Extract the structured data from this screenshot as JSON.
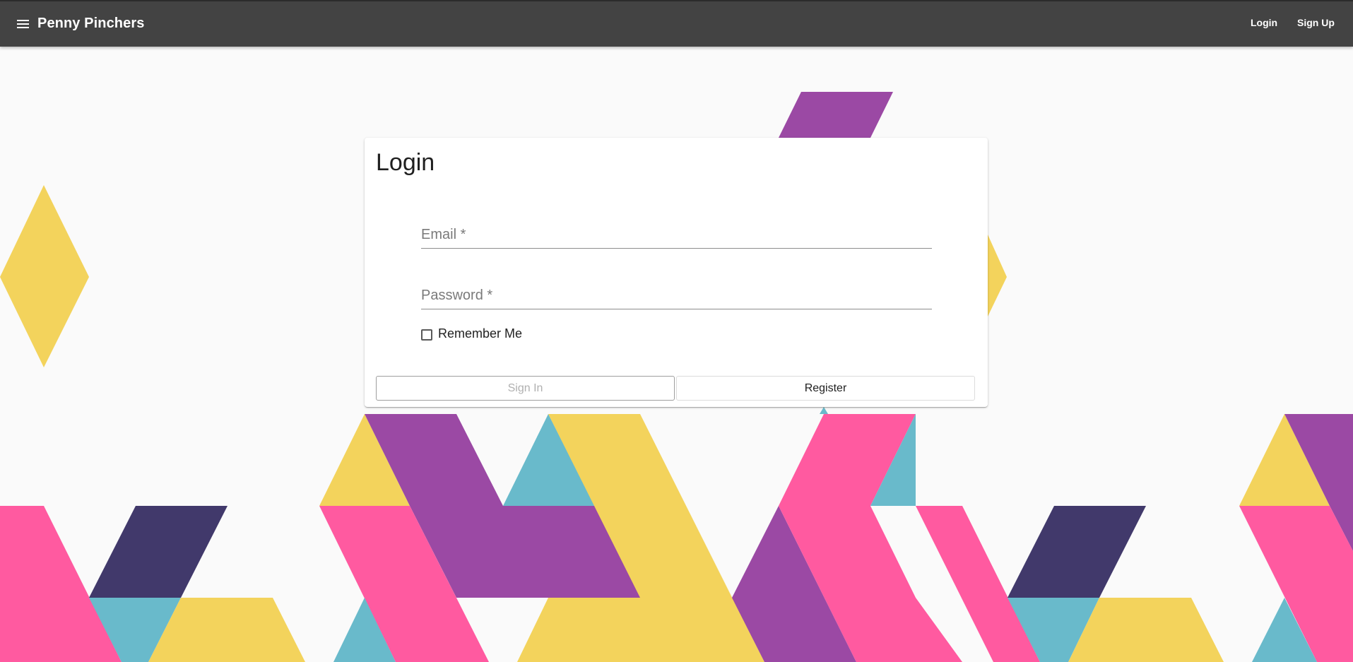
{
  "appbar": {
    "menu_icon": "menu-icon",
    "title": "Penny Pinchers",
    "login_label": "Login",
    "signup_label": "Sign Up"
  },
  "login": {
    "title": "Login",
    "email": {
      "label": "Email *",
      "value": ""
    },
    "password": {
      "label": "Password *",
      "value": ""
    },
    "remember_label": "Remember Me",
    "remember_checked": false,
    "signin_label": "Sign In",
    "register_label": "Register"
  },
  "colors": {
    "appbar": "#434343",
    "background": "#fafafa",
    "yellow": "#f3d35c",
    "purple": "#9b49a4",
    "pink": "#ff5aa0",
    "teal": "#69bacb",
    "navy": "#41396b"
  }
}
